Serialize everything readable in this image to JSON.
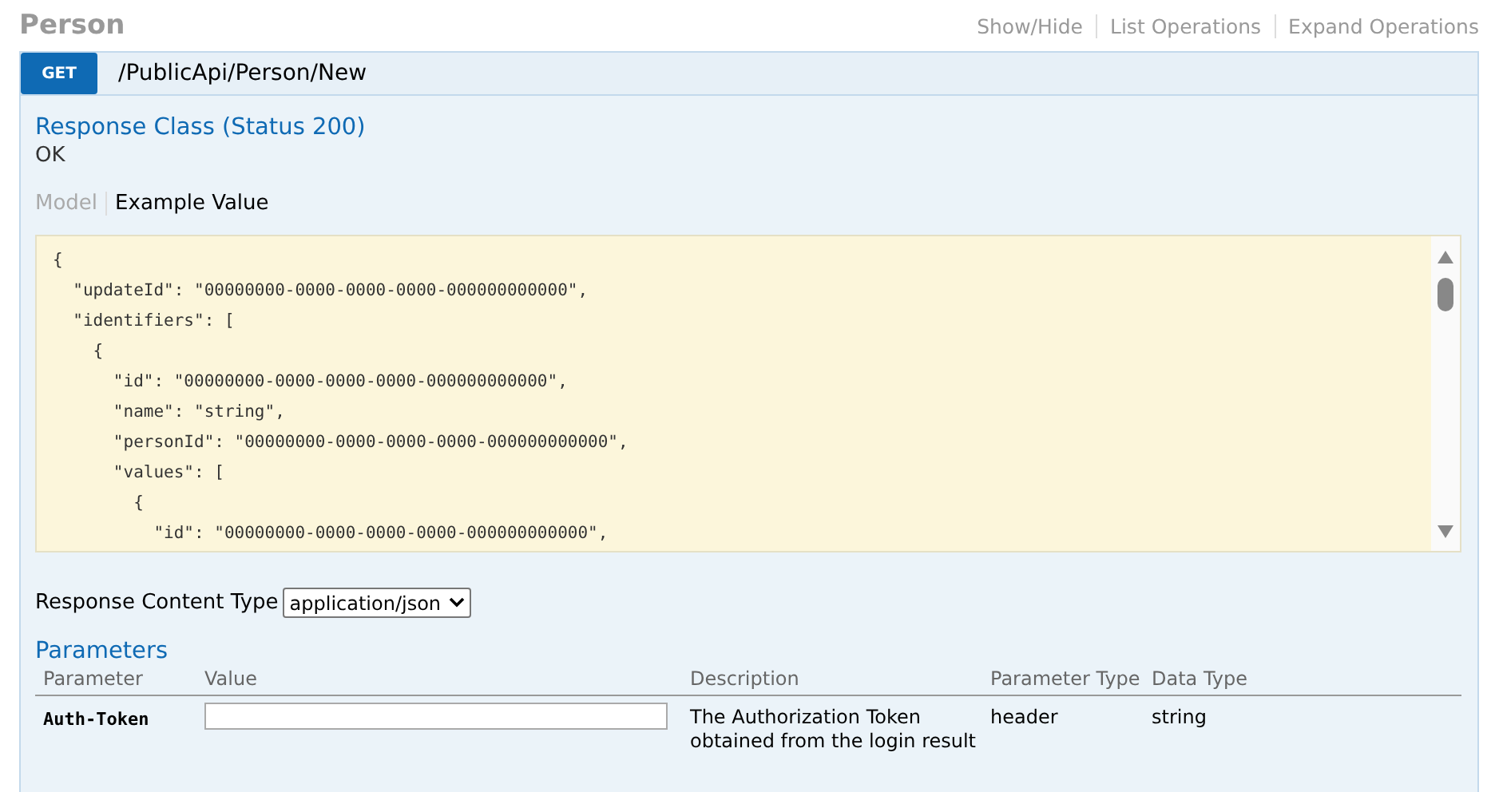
{
  "resource": {
    "title": "Person",
    "links": [
      "Show/Hide",
      "List Operations",
      "Expand Operations"
    ]
  },
  "operation": {
    "method": "GET",
    "path": "/PublicApi/Person/New"
  },
  "response_class": {
    "heading": "Response Class (Status 200)",
    "status_text": "OK",
    "tabs": [
      {
        "label": "Model",
        "selected": false
      },
      {
        "label": "Example Value",
        "selected": true
      }
    ],
    "example_lines": [
      "{",
      "  \"updateId\": \"00000000-0000-0000-0000-000000000000\",",
      "  \"identifiers\": [",
      "    {",
      "      \"id\": \"00000000-0000-0000-0000-000000000000\",",
      "      \"name\": \"string\",",
      "      \"personId\": \"00000000-0000-0000-0000-000000000000\",",
      "      \"values\": [",
      "        {",
      "          \"id\": \"00000000-0000-0000-0000-000000000000\","
    ]
  },
  "response_content_type": {
    "label": "Response Content Type",
    "value": "application/json"
  },
  "parameters": {
    "heading": "Parameters",
    "columns": [
      "Parameter",
      "Value",
      "Description",
      "Parameter Type",
      "Data Type"
    ],
    "rows": [
      {
        "name": "Auth-Token",
        "value": "",
        "description": "The Authorization Token obtained from the login result",
        "parameter_type": "header",
        "data_type": "string"
      }
    ]
  }
}
